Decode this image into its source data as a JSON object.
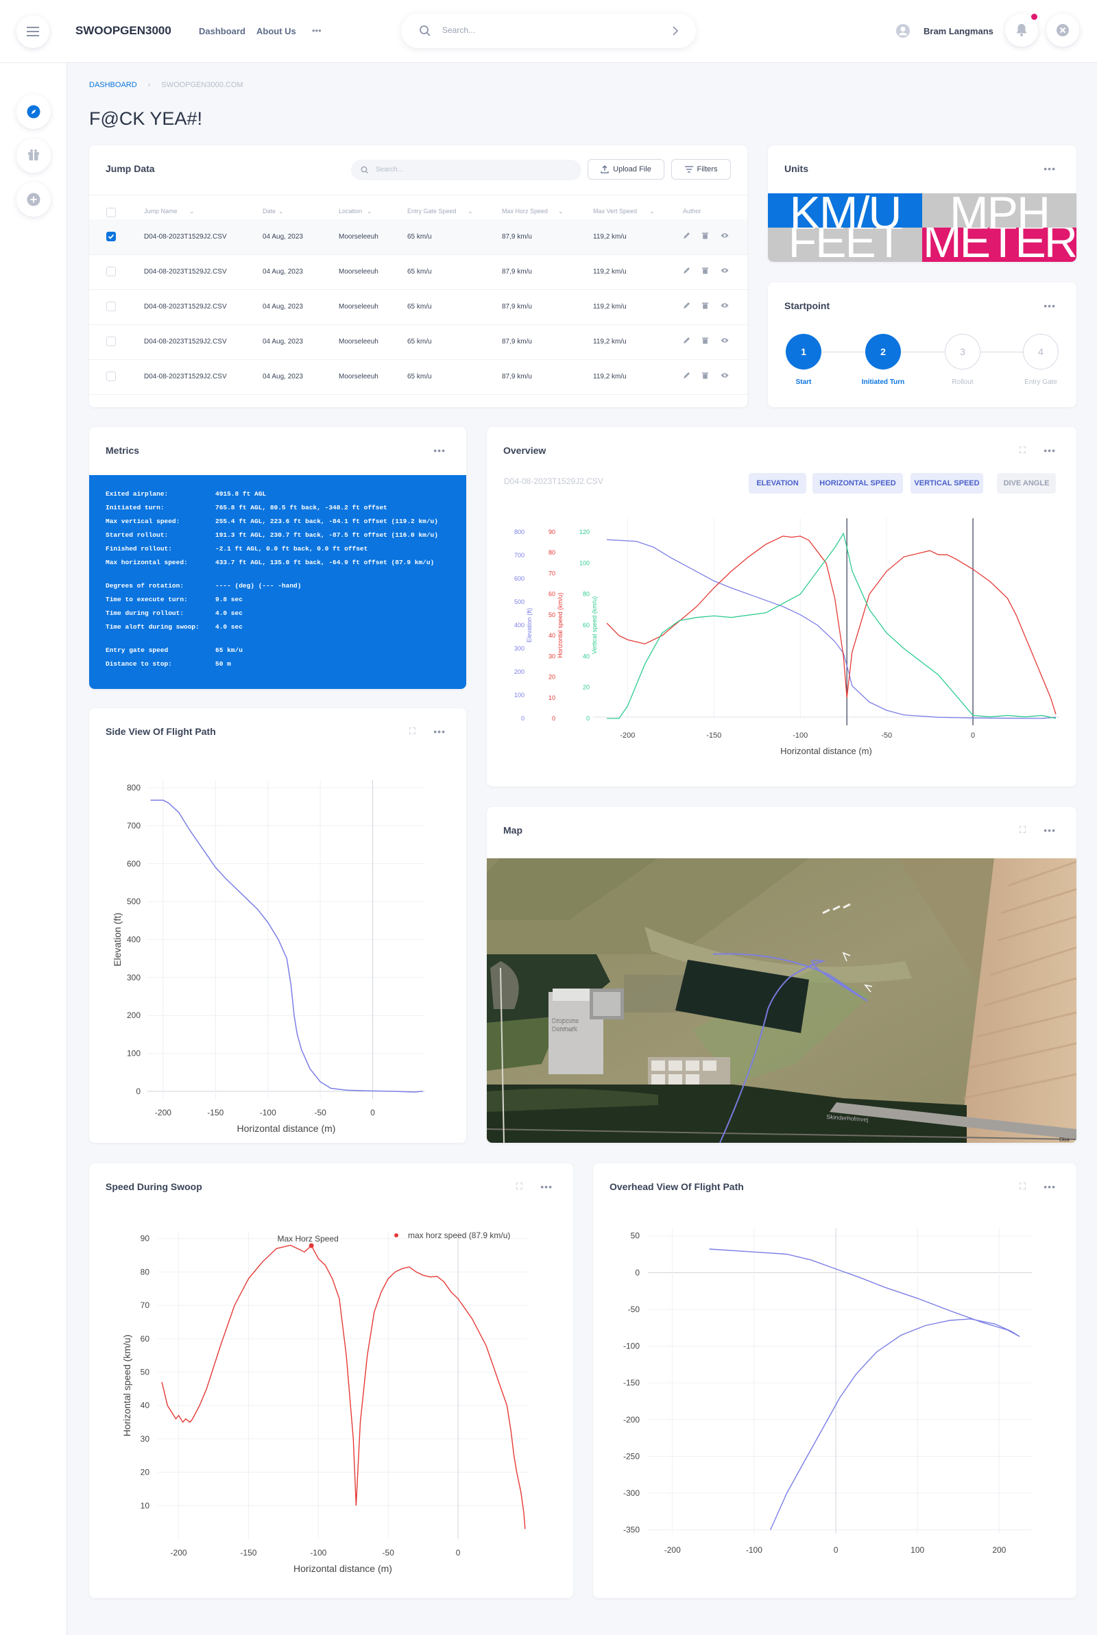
{
  "app": {
    "brand": "SWOOPGEN3000",
    "nav": [
      "Dashboard",
      "About Us"
    ],
    "more": "•••"
  },
  "search": {
    "placeholder": "Search..."
  },
  "user": {
    "name": "Bram Langmans"
  },
  "breadcrumb": {
    "first": "DASHBOARD",
    "second": "SWOOPGEN3000.COM"
  },
  "page": {
    "title": "F@CK YEA#!"
  },
  "jump_data": {
    "title": "Jump Data",
    "search_placeholder": "Search...",
    "upload_label": "Upload File",
    "filters_label": "Filters",
    "columns": [
      "Jump Name",
      "Date",
      "Location",
      "Entry Gate Speed",
      "Max Horz Speed",
      "Max Vert Speed",
      "Author"
    ],
    "rows": [
      {
        "name": "D04-08-2023T1529J2.CSV",
        "date": "04 Aug, 2023",
        "location": "Moorseleeuh",
        "entry": "65 km/u",
        "horz": "87,9 km/u",
        "vert": "119,2 km/u",
        "checked": true
      },
      {
        "name": "D04-08-2023T1529J2.CSV",
        "date": "04 Aug, 2023",
        "location": "Moorseleeuh",
        "entry": "65 km/u",
        "horz": "87,9 km/u",
        "vert": "119,2 km/u",
        "checked": false
      },
      {
        "name": "D04-08-2023T1529J2.CSV",
        "date": "04 Aug, 2023",
        "location": "Moorseleeuh",
        "entry": "65 km/u",
        "horz": "87,9 km/u",
        "vert": "119,2 km/u",
        "checked": false
      },
      {
        "name": "D04-08-2023T1529J2.CSV",
        "date": "04 Aug, 2023",
        "location": "Moorseleeuh",
        "entry": "65 km/u",
        "horz": "87,9 km/u",
        "vert": "119,2 km/u",
        "checked": false
      },
      {
        "name": "D04-08-2023T1529J2.CSV",
        "date": "04 Aug, 2023",
        "location": "Moorseleeuh",
        "entry": "65 km/u",
        "horz": "87,9 km/u",
        "vert": "119,2 km/u",
        "checked": false
      }
    ]
  },
  "units": {
    "title": "Units",
    "kmu": "KM/U",
    "mph": "MPH",
    "feet": "FEET",
    "meter": "METER",
    "colors": {
      "blue": "#0b74de",
      "grey": "#c8c8c8",
      "pink": "#e0186e"
    }
  },
  "startpoint": {
    "title": "Startpoint",
    "steps": [
      {
        "num": "1",
        "label": "Start",
        "active": true
      },
      {
        "num": "2",
        "label": "Initiated Turn",
        "active": true
      },
      {
        "num": "3",
        "label": "Rollout",
        "active": false
      },
      {
        "num": "4",
        "label": "Entry Gate",
        "active": false
      }
    ]
  },
  "metrics": {
    "title": "Metrics",
    "lines": [
      [
        "Exited airplane:",
        "4915.8 ft AGL"
      ],
      [
        "Initiated turn:",
        "765.8 ft AGL, 80.5 ft back, -348.2 ft offset"
      ],
      [
        "Max vertical speed:",
        "255.4 ft AGL, 223.6 ft back, -84.1 ft offset (119.2 km/u)"
      ],
      [
        "Started rollout:",
        "191.3 ft AGL, 230.7 ft back, -87.5 ft offset (116.0 km/u)"
      ],
      [
        "Finished rollout:",
        "-2.1 ft AGL, 0.0 ft back, 0.0 ft offset"
      ],
      [
        "Max horizontal speed:",
        "433.7 ft AGL, 135.0 ft back, -64.9 ft offset (87.9 km/u)"
      ],
      [
        "",
        ""
      ],
      [
        "Degrees of rotation:",
        "---- (deg) (--- -hand)"
      ],
      [
        "Time to execute turn:",
        "9.8 sec"
      ],
      [
        "Time during rollout:",
        "4.0 sec"
      ],
      [
        "Time aloft during swoop:",
        "4.0 sec"
      ],
      [
        "",
        ""
      ],
      [
        "Entry gate speed",
        "65 km/u"
      ],
      [
        "Distance to stop:",
        "50 m"
      ]
    ]
  },
  "overview": {
    "title": "Overview",
    "file": "D04-08-2023T1529J2.CSV",
    "buttons": [
      "ELEVATION",
      "HORIZONTAL SPEED",
      "VERTICAL SPEED",
      "DIVE ANGLE"
    ]
  },
  "map": {
    "title": "Map",
    "labels": [
      "Skinderholmvej",
      "Dropzone Denmark",
      "Dba"
    ]
  },
  "colors": {
    "accent": "#0b74de",
    "elevation": "#7b7ee6",
    "horizontal": "#e53935",
    "vertical": "#2ecc8e"
  },
  "chart_data": [
    {
      "type": "line",
      "title": "Overview",
      "xlabel": "Horizontal distance (m)",
      "xlim": [
        -220,
        50
      ],
      "xticks": [
        -200,
        -150,
        -100,
        -50,
        0
      ],
      "axes": [
        {
          "label": "Elevation (ft)",
          "ylim": [
            0,
            800
          ],
          "ticks": [
            0,
            100,
            200,
            300,
            400,
            500,
            600,
            700,
            800
          ]
        },
        {
          "label": "Horizontal speed (km/u)",
          "ylim": [
            0,
            90
          ],
          "ticks": [
            0,
            10,
            20,
            30,
            40,
            50,
            60,
            70,
            80,
            90
          ]
        },
        {
          "label": "Vertical speed (km/u)",
          "ylim": [
            0,
            120
          ],
          "ticks": [
            0,
            20,
            40,
            60,
            80,
            100,
            120
          ]
        }
      ],
      "vlines": [
        -73,
        0
      ],
      "series": [
        {
          "axis": 0,
          "x": [
            -212,
            -195,
            -185,
            -175,
            -160,
            -150,
            -140,
            -125,
            -110,
            -100,
            -90,
            -80,
            -75,
            -72,
            -70,
            -60,
            -50,
            -40,
            -20,
            0,
            20,
            40,
            48
          ],
          "y": [
            767,
            760,
            735,
            690,
            630,
            590,
            560,
            520,
            480,
            445,
            400,
            330,
            280,
            200,
            140,
            70,
            35,
            15,
            5,
            2,
            1,
            0,
            5
          ]
        },
        {
          "axis": 1,
          "x": [
            -212,
            -205,
            -200,
            -195,
            -190,
            -180,
            -160,
            -150,
            -140,
            -130,
            -120,
            -110,
            -105,
            -100,
            -95,
            -85,
            -80,
            -75,
            -73,
            -70,
            -60,
            -50,
            -40,
            -30,
            -25,
            -20,
            -15,
            -10,
            0,
            10,
            20,
            25,
            30,
            35,
            40,
            45,
            48
          ],
          "y": [
            46,
            40,
            38,
            37,
            36,
            40,
            54,
            63,
            71,
            78,
            84,
            88,
            87.5,
            88,
            86,
            75,
            58,
            30,
            10,
            32,
            60,
            71,
            78,
            80,
            81,
            79,
            79,
            77,
            72,
            66,
            58,
            50,
            40,
            30,
            20,
            10,
            2
          ]
        },
        {
          "axis": 2,
          "x": [
            -212,
            -205,
            -200,
            -190,
            -180,
            -170,
            -160,
            -150,
            -140,
            -120,
            -100,
            -90,
            -80,
            -75,
            -73,
            -70,
            -60,
            -50,
            -40,
            -20,
            0,
            10,
            20,
            30,
            40,
            48
          ],
          "y": [
            0,
            0,
            8,
            35,
            55,
            63,
            65,
            66,
            65,
            68,
            80,
            95,
            110,
            119,
            110,
            95,
            70,
            55,
            45,
            28,
            2,
            1,
            2,
            1,
            2,
            0
          ]
        }
      ]
    },
    {
      "type": "line",
      "title": "Side View Of Flight Path",
      "xlabel": "Horizontal distance (m)",
      "ylabel": "Elevation (ft)",
      "xlim": [
        -215,
        50
      ],
      "ylim": [
        -20,
        820
      ],
      "xticks": [
        -200,
        -150,
        -100,
        -50,
        0
      ],
      "yticks": [
        0,
        100,
        200,
        300,
        400,
        500,
        600,
        700,
        800
      ],
      "series": [
        {
          "x": [
            -212,
            -200,
            -195,
            -185,
            -175,
            -160,
            -150,
            -140,
            -125,
            -110,
            -100,
            -90,
            -82,
            -78,
            -75,
            -72,
            -68,
            -60,
            -50,
            -40,
            -25,
            0,
            20,
            30,
            40,
            48
          ],
          "y": [
            767,
            767,
            760,
            735,
            690,
            630,
            590,
            560,
            520,
            480,
            445,
            400,
            350,
            280,
            200,
            150,
            110,
            60,
            25,
            8,
            3,
            1,
            0,
            -1,
            -2,
            0
          ]
        }
      ]
    },
    {
      "type": "line",
      "title": "Speed During Swoop",
      "xlabel": "Horizontal distance (m)",
      "ylabel": "Horizontal speed (km/u)",
      "xlim": [
        -215,
        50
      ],
      "ylim": [
        0,
        92
      ],
      "xticks": [
        -200,
        -150,
        -100,
        -50,
        0
      ],
      "yticks": [
        10,
        20,
        30,
        40,
        50,
        60,
        70,
        80,
        90
      ],
      "legend": [
        "Max Horz Speed",
        "max horz speed (87.9 km/u)"
      ],
      "max_point": {
        "x": -105,
        "y": 87.9
      },
      "series": [
        {
          "x": [
            -212,
            -208,
            -205,
            -202,
            -200,
            -197,
            -195,
            -192,
            -190,
            -185,
            -180,
            -170,
            -160,
            -150,
            -140,
            -130,
            -120,
            -115,
            -110,
            -105,
            -100,
            -95,
            -90,
            -85,
            -80,
            -75,
            -73,
            -70,
            -65,
            -60,
            -55,
            -50,
            -45,
            -40,
            -35,
            -30,
            -25,
            -20,
            -15,
            -10,
            -5,
            0,
            10,
            20,
            25,
            30,
            35,
            38,
            40,
            42,
            45,
            47,
            48
          ],
          "y": [
            47,
            40,
            38,
            36,
            37,
            35,
            36,
            35,
            36,
            40,
            45,
            58,
            70,
            78,
            83,
            87,
            88,
            87,
            86,
            87.9,
            84,
            82,
            78,
            72,
            55,
            30,
            10,
            35,
            55,
            68,
            74,
            78,
            80,
            81,
            81.5,
            80,
            79,
            78.5,
            78.7,
            77,
            74,
            72,
            66,
            58,
            52,
            46,
            40,
            32,
            25,
            20,
            14,
            8,
            3
          ]
        }
      ]
    },
    {
      "type": "line",
      "title": "Overhead View Of Flight Path",
      "xlim": [
        -230,
        240
      ],
      "ylim": [
        -355,
        60
      ],
      "xticks": [
        -200,
        -100,
        0,
        100,
        200
      ],
      "yticks": [
        50,
        0,
        -50,
        -100,
        -150,
        -200,
        -250,
        -300,
        -350
      ],
      "series": [
        {
          "x": [
            -155,
            -100,
            -60,
            -30,
            0,
            30,
            60,
            100,
            140,
            180,
            210,
            225,
            215,
            195,
            165,
            140,
            110,
            80,
            50,
            25,
            5,
            -15,
            -35,
            -60,
            -80
          ],
          "y": [
            32,
            28,
            25,
            17,
            5,
            -7,
            -20,
            -35,
            -52,
            -68,
            -78,
            -87,
            -80,
            -70,
            -63,
            -65,
            -72,
            -85,
            -108,
            -138,
            -170,
            -210,
            -250,
            -300,
            -350
          ]
        }
      ]
    }
  ]
}
